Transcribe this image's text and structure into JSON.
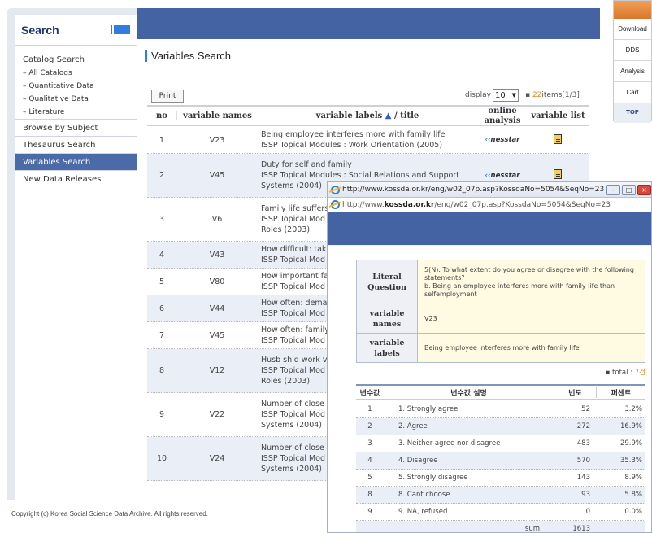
{
  "sidebar": {
    "title": "Search",
    "items": [
      {
        "label": "Catalog Search",
        "kind": "top"
      },
      {
        "label": "– All Catalogs",
        "kind": "sub"
      },
      {
        "label": "– Quantitative Data",
        "kind": "sub"
      },
      {
        "label": "– Qualitative Data",
        "kind": "sub"
      },
      {
        "label": "– Literature",
        "kind": "sub"
      },
      {
        "label": "Browse by Subject",
        "kind": "sep"
      },
      {
        "label": "Thesaurus Search",
        "kind": "sep"
      },
      {
        "label": "Variables Search",
        "kind": "active"
      },
      {
        "label": "New Data Releases",
        "kind": "sep"
      }
    ]
  },
  "footer": {
    "copyright": "Copyright (c) Korea Social Science Data Archive. All rights reserved."
  },
  "main": {
    "title": "Variables Search",
    "print_label": "Print",
    "display_label": "display",
    "display_value": "10",
    "items_count": "22",
    "items_suffix": "items[1/3]",
    "columns": {
      "no": "no",
      "var": "variable names",
      "lab": "variable labels",
      "lab_arrow": "▲",
      "lab_suffix": "/ title",
      "online": "online analysis",
      "list": "variable list"
    },
    "rows": [
      {
        "no": "1",
        "var": "V23",
        "lines": [
          "Being employee interferes more with family life",
          "ISSP Topical Modules : Work Orientation (2005)"
        ],
        "nesstar": true
      },
      {
        "no": "2",
        "var": "V45",
        "lines": [
          "Duty for self and family",
          "ISSP Topical Modules : Social Relations and Support",
          "Systems (2004)"
        ],
        "nesstar": true
      },
      {
        "no": "3",
        "var": "V6",
        "lines": [
          "Family life suffers",
          "ISSP Topical Mod",
          "Roles (2003)"
        ],
        "nesstar": false
      },
      {
        "no": "4",
        "var": "V43",
        "lines": [
          "How difficult: tak",
          "ISSP Topical Mod"
        ],
        "nesstar": false
      },
      {
        "no": "5",
        "var": "V80",
        "lines": [
          "How important fa",
          "ISSP Topical Mod"
        ],
        "nesstar": false
      },
      {
        "no": "6",
        "var": "V44",
        "lines": [
          "How often: dema",
          "ISSP Topical Mod"
        ],
        "nesstar": false
      },
      {
        "no": "7",
        "var": "V45",
        "lines": [
          "How often: family",
          "ISSP Topical Mod"
        ],
        "nesstar": false
      },
      {
        "no": "8",
        "var": "V12",
        "lines": [
          "Husb shld work v",
          "ISSP Topical Mod",
          "Roles (2003)"
        ],
        "nesstar": false
      },
      {
        "no": "9",
        "var": "V22",
        "lines": [
          "Number of close",
          "ISSP Topical Mod",
          "Systems (2004)"
        ],
        "nesstar": false
      },
      {
        "no": "10",
        "var": "V24",
        "lines": [
          "Number of close",
          "ISSP Topical Mod",
          "Systems (2004)"
        ],
        "nesstar": false
      }
    ],
    "nesstar_prefix": "‹‹",
    "nesstar_label": "nesstar"
  },
  "quick_menu": {
    "items": [
      "Download",
      "DDS",
      "Analysis",
      "Cart"
    ],
    "top": "TOP"
  },
  "popup": {
    "title": "http://www.kossda.or.kr/eng/w02_07p.asp?KossdaNo=5054&SeqNo=23 ...",
    "url_prefix": "http://www.",
    "url_bold": "kossda.or.kr",
    "url_suffix": "/eng/w02_07p.asp?KossdaNo=5054&SeqNo=23",
    "literal_label": "Literal Question",
    "literal_lines": [
      "5(N). To what extent do you agree or disagree with the following statements?",
      "b. Being an employee interferes more with family life than selfemployment"
    ],
    "varname_label": "variable names",
    "varname_value": "V23",
    "varlabel_label": "variable labels",
    "varlabel_value": "Being employee interferes more with family life",
    "total_prefix": "▪ total :",
    "total_value": "7건",
    "freq_headers": {
      "val": "변수값",
      "desc": "변수값 설명",
      "freq": "빈도",
      "pct": "퍼센트"
    },
    "freq_rows": [
      {
        "val": "1",
        "desc": "1. Strongly agree",
        "freq": "52",
        "pct": "3.2%"
      },
      {
        "val": "2",
        "desc": "2. Agree",
        "freq": "272",
        "pct": "16.9%"
      },
      {
        "val": "3",
        "desc": "3. Neither agree nor disagree",
        "freq": "483",
        "pct": "29.9%"
      },
      {
        "val": "4",
        "desc": "4. Disagree",
        "freq": "570",
        "pct": "35.3%"
      },
      {
        "val": "5",
        "desc": "5. Strongly disagree",
        "freq": "143",
        "pct": "8.9%"
      },
      {
        "val": "8",
        "desc": "8. Cant choose",
        "freq": "93",
        "pct": "5.8%"
      },
      {
        "val": "9",
        "desc": "9. NA, refused",
        "freq": "0",
        "pct": "0.0%"
      }
    ],
    "sum_label": "sum",
    "sum_value": "1613"
  }
}
